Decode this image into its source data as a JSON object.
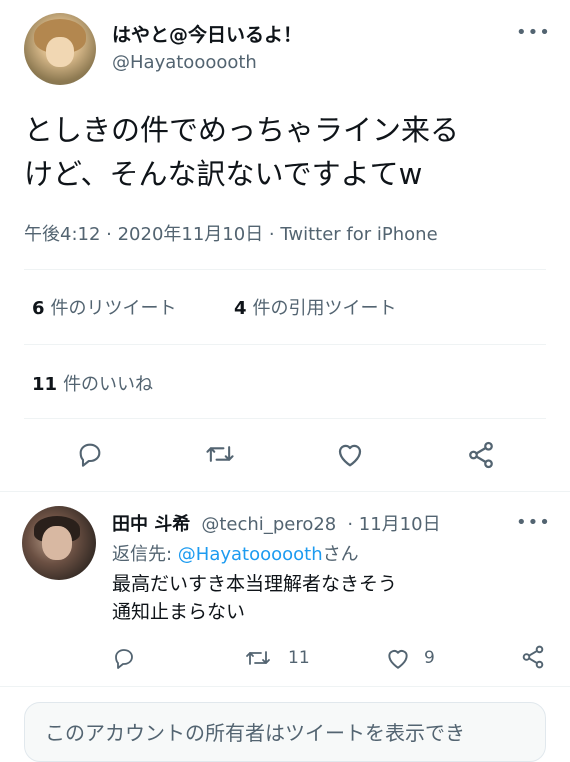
{
  "tweet": {
    "author_name": "はやと@今日いるよ！",
    "author_handle": "@Hayatoooooth",
    "more_label": "•••",
    "text_line1": "としきの件でめっちゃライン来る",
    "text_line2": "けど、そんな訳ないですよてw",
    "timestamp": "午後4:12 · 2020年11月10日 · Twitter for iPhone",
    "retweets_count": "6",
    "retweets_label": "件のリツイート",
    "quotes_count": "4",
    "quotes_label": "件の引用ツイート",
    "likes_count": "11",
    "likes_label": "件のいいね",
    "actions": [
      "reply-icon",
      "retweet-icon",
      "like-icon",
      "share-icon"
    ]
  },
  "reply": {
    "author_name": "田中 斗希",
    "author_handle": "@techi_pero28",
    "date": "· 11月10日",
    "more_label": "•••",
    "replying_to_prefix": "返信先: ",
    "replying_to_handle": "@Hayatoooooth",
    "replying_to_suffix": "さん",
    "text_line1": "最高だいすき本当理解者なきそう",
    "text_line2": "通知止まらない",
    "retweet_count": "11",
    "like_count": "9",
    "actions": [
      "reply-icon",
      "retweet-icon",
      "like-icon",
      "share-icon"
    ]
  },
  "notice": {
    "text": "このアカウントの所有者はツイートを表示でき"
  },
  "colors": {
    "text_primary": "#0f1419",
    "text_secondary": "#536471",
    "link": "#1d9bf0",
    "divider": "#eff3f4"
  }
}
